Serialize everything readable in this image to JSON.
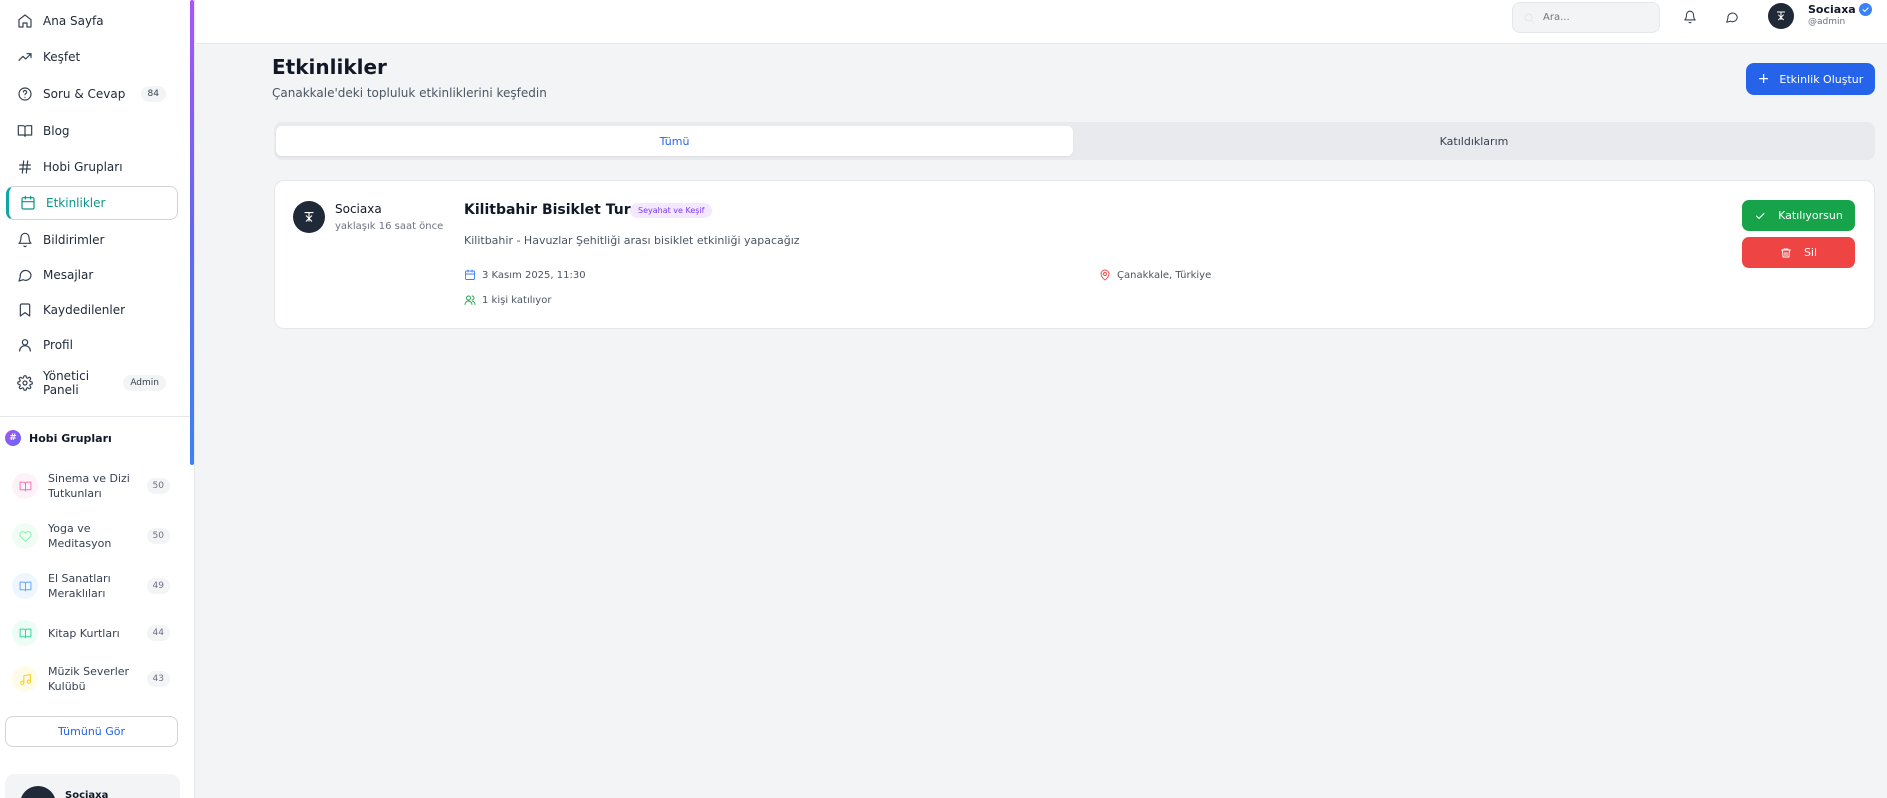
{
  "sidebar": {
    "nav": [
      {
        "label": "Ana Sayfa",
        "icon": "home-icon"
      },
      {
        "label": "Keşfet",
        "icon": "trending-icon"
      },
      {
        "label": "Soru & Cevap",
        "icon": "help-circle-icon",
        "badge": "84"
      },
      {
        "label": "Blog",
        "icon": "book-open-icon"
      },
      {
        "label": "Hobi Grupları",
        "icon": "hash-icon"
      },
      {
        "label": "Etkinlikler",
        "icon": "calendar-icon",
        "active": true
      },
      {
        "label": "Bildirimler",
        "icon": "bell-icon"
      },
      {
        "label": "Mesajlar",
        "icon": "message-icon"
      },
      {
        "label": "Kaydedilenler",
        "icon": "bookmark-icon"
      },
      {
        "label": "Profil",
        "icon": "user-icon"
      },
      {
        "label": "Yönetici Paneli",
        "icon": "settings-icon",
        "badge": "Admin"
      }
    ],
    "hobby_title": "Hobi Grupları",
    "groups": [
      {
        "name": "Sinema ve Dizi Tutkunları",
        "count": "50",
        "color": "#f472b6"
      },
      {
        "name": "Yoga ve Meditasyon",
        "count": "50",
        "color": "#86efac"
      },
      {
        "name": "El Sanatları Meraklıları",
        "count": "49",
        "color": "#60a5fa"
      },
      {
        "name": "Kitap Kurtları",
        "count": "44",
        "color": "#34d399"
      },
      {
        "name": "Müzik Severler Kulübü",
        "count": "43",
        "color": "#facc15"
      }
    ],
    "see_all": "Tümünü Gör",
    "user_card_name": "Sociaxa"
  },
  "topbar": {
    "search_placeholder": "Ara...",
    "user_name": "Sociaxa",
    "user_handle": "@admin"
  },
  "main": {
    "title": "Etkinlikler",
    "subtitle": "Çanakkale'deki topluluk etkinliklerini keşfedin",
    "create_label": "Etkinlik Oluştur",
    "tabs": [
      {
        "label": "Tümü",
        "active": true
      },
      {
        "label": "Katıldıklarım",
        "active": false
      }
    ]
  },
  "event": {
    "author": "Sociaxa",
    "time": "yaklaşık 16 saat önce",
    "title": "Kilitbahir Bisiklet Turu",
    "category": "Seyahat ve Keşif",
    "description": "Kilitbahir - Havuzlar Şehitliği arası bisiklet etkinliği yapacağız",
    "date": "3 Kasım 2025, 11:30",
    "location": "Çanakkale, Türkiye",
    "attendees": "1 kişi katılıyor",
    "join_label": "Katılıyorsun",
    "delete_label": "Sil"
  },
  "colors": {
    "primary": "#2563eb",
    "success": "#16a34a",
    "danger": "#ef4444",
    "active_nav": "#0d9488"
  }
}
